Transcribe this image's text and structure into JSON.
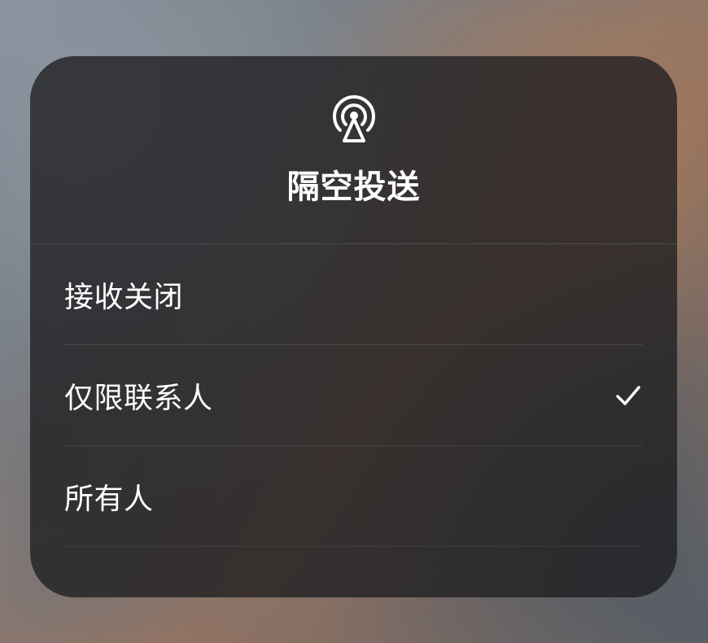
{
  "panel": {
    "title": "隔空投送",
    "icon": "airdrop-icon",
    "options": [
      {
        "label": "接收关闭",
        "selected": false
      },
      {
        "label": "仅限联系人",
        "selected": true
      },
      {
        "label": "所有人",
        "selected": false
      }
    ]
  }
}
